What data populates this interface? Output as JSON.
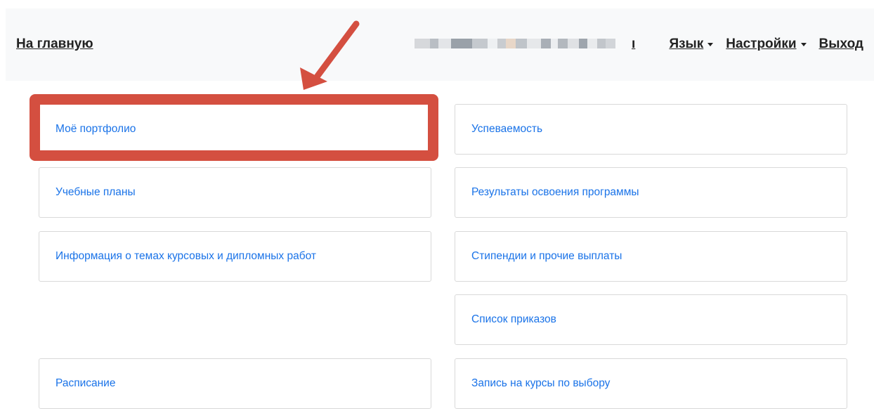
{
  "navbar": {
    "home_label": "На главную",
    "user_name_tail": "ı",
    "language_label": "Язык",
    "settings_label": "Настройки",
    "logout_label": "Выход"
  },
  "cards": {
    "portfolio": "Моё портфолио",
    "performance": "Успеваемость",
    "curricula": "Учебные планы",
    "program_results": "Результаты освоения программы",
    "thesis_topics": "Информация о темах курсовых и дипломных работ",
    "scholarships": "Стипендии и прочие выплаты",
    "orders": "Список приказов",
    "schedule": "Расписание",
    "elective_enrollment": "Запись на курсы по выбору"
  },
  "colors": {
    "link": "#1a73e8",
    "annotation": "#d44f40",
    "navbar_bg": "#f8f9fa"
  }
}
